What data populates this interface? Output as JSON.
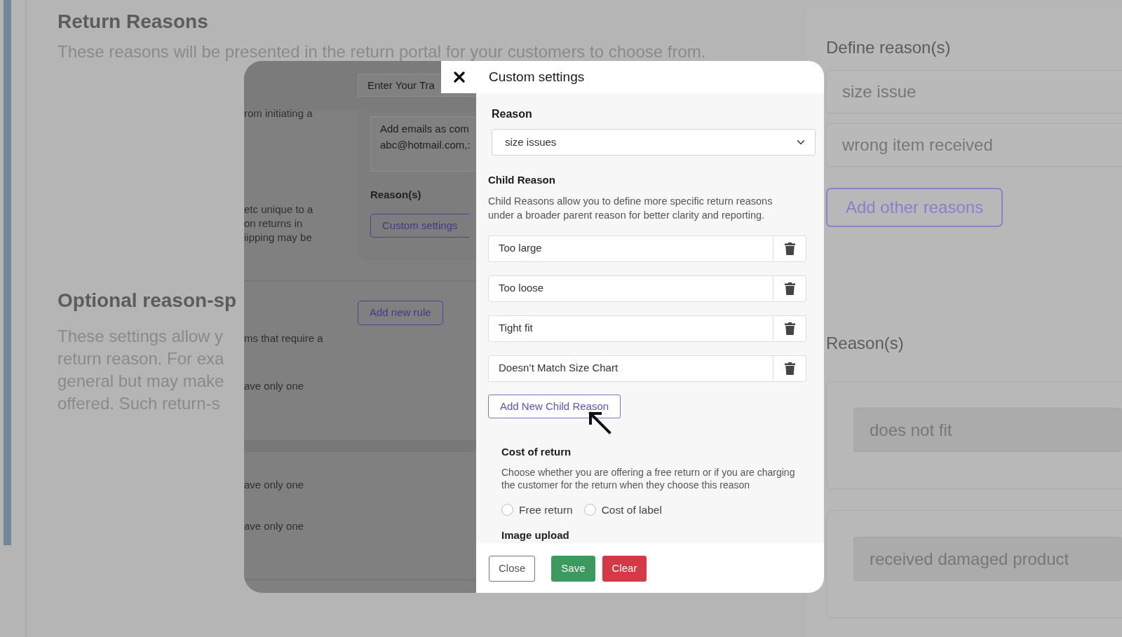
{
  "page": {
    "title": "Return Reasons",
    "description": "These reasons will be presented in the return portal for your customers to choose from.",
    "optional_title": "Optional reason-sp",
    "optional_lines": [
      "These settings allow y",
      "return reason. For exa",
      "general but may make",
      "offered. Such return-s"
    ]
  },
  "right_panel": {
    "title": "Define reason(s)",
    "reasons": [
      "size issue",
      "wrong item received"
    ],
    "add_button": "Add other reasons",
    "list_title": "Reason(s)",
    "cards": [
      "does not fit",
      "received damaged product"
    ]
  },
  "back_dialog": {
    "search": {
      "placeholder": "Enter Your Tra"
    },
    "side_texts": [
      [
        "rom initiating a"
      ],
      [
        "etc unique to a",
        "on returns in",
        "iipping may be"
      ],
      [
        "ms that require a"
      ],
      [
        "ave only one"
      ],
      [
        "ave only one"
      ],
      [
        "ave only one"
      ]
    ],
    "emails": {
      "placeholder": "Add emails as com\nabc@hotmail.com,:"
    },
    "reasons_label": "Reason(s)",
    "custom_button": "Custom settings",
    "add_rule_button": "Add new rule"
  },
  "modal": {
    "title": "Custom settings",
    "reason_label": "Reason",
    "reason_value": "size issues",
    "child_title": "Child Reason",
    "child_description": "Child Reasons allow you to define more specific return reasons under a broader parent reason for better clarity and reporting.",
    "child_reasons": [
      {
        "value": "Too large"
      },
      {
        "value": "Too loose"
      },
      {
        "value": "Tight fit"
      },
      {
        "value": "Doesn’t Match Size Chart"
      }
    ],
    "add_child_button": "Add New Child Reason",
    "cost_title": "Cost of return",
    "cost_description": "Choose whether you are offering a free return or if you are charging the customer for the return when they choose this reason",
    "cost_options": [
      {
        "label": "Free return",
        "selected": false
      },
      {
        "label": "Cost of label",
        "selected": false
      }
    ],
    "next_section": "Image upload",
    "buttons": [
      {
        "label": "Close",
        "kind": "secondary"
      },
      {
        "label": "Save",
        "kind": "success"
      },
      {
        "label": "Clear",
        "kind": "danger"
      }
    ]
  }
}
